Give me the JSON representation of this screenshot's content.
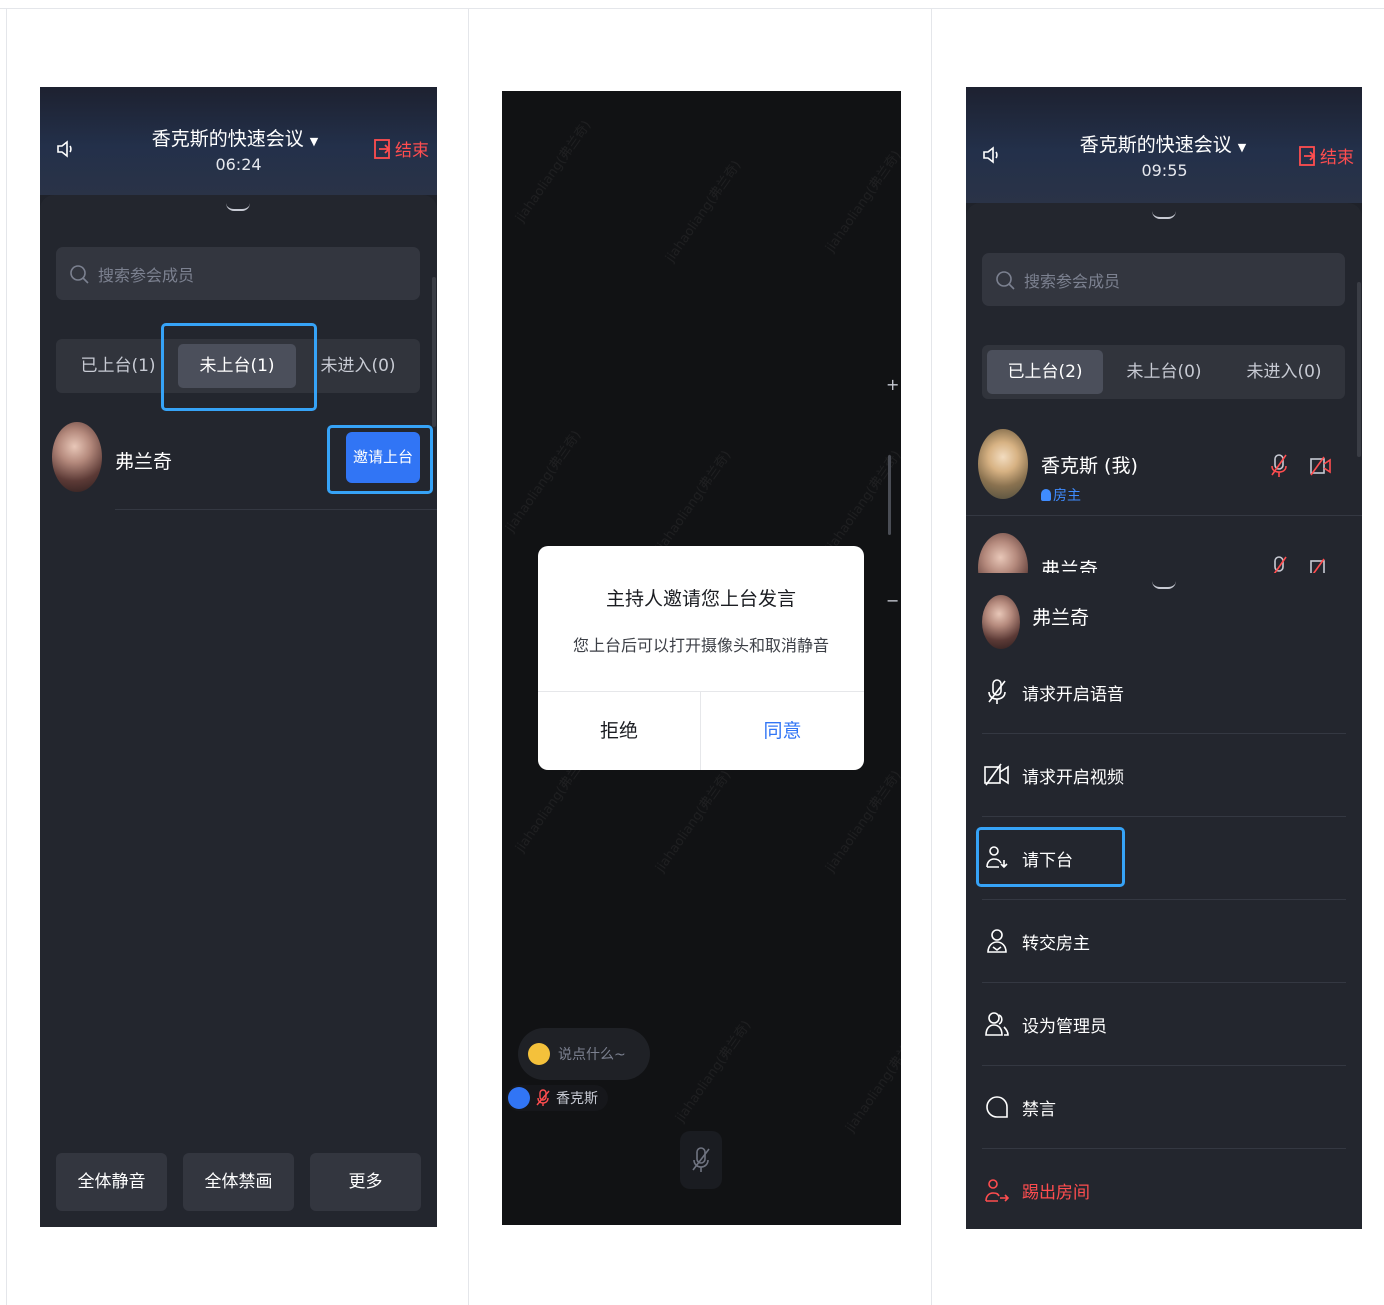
{
  "panel1": {
    "title": "香克斯的快速会议",
    "timer": "06:24",
    "end_label": "结束",
    "search_placeholder": "搜索参会成员",
    "tabs": [
      "已上台(1)",
      "未上台(1)",
      "未进入(0)"
    ],
    "member": {
      "name": "弗兰奇",
      "action": "邀请上台"
    },
    "bottom": [
      "全体静音",
      "全体禁画",
      "更多"
    ]
  },
  "panel2": {
    "dialog_title": "主持人邀请您上台发言",
    "dialog_message": "您上台后可以打开摄像头和取消静音",
    "reject": "拒绝",
    "agree": "同意",
    "chat_placeholder": "说点什么~",
    "speaker_name": "香克斯",
    "watermark": "jiahaoliang(弗兰奇)",
    "zoom_plus": "+",
    "zoom_minus": "−"
  },
  "panel3": {
    "title": "香克斯的快速会议",
    "timer": "09:55",
    "end_label": "结束",
    "search_placeholder": "搜索参会成员",
    "tabs": [
      "已上台(2)",
      "未上台(0)",
      "未进入(0)"
    ],
    "members": [
      {
        "name": "香克斯 (我)",
        "role": "房主"
      },
      {
        "name": "弗兰奇"
      }
    ],
    "sheet_user": "弗兰奇",
    "menu": [
      "请求开启语音",
      "请求开启视频",
      "请下台",
      "转交房主",
      "设为管理员",
      "禁言",
      "踢出房间"
    ]
  },
  "colors": {
    "accent": "#3175f5",
    "highlight": "#36a3f7",
    "danger": "#ff4d4f",
    "bg_dark": "#23262e"
  }
}
